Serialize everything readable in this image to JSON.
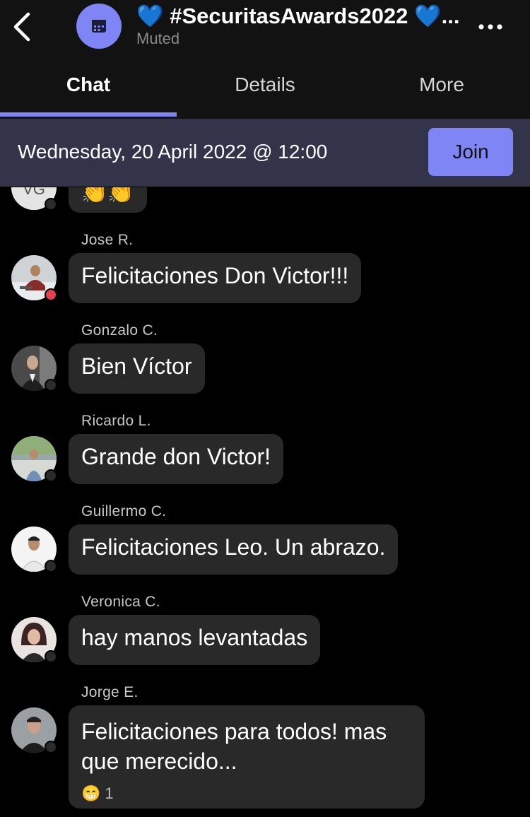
{
  "header": {
    "title": "💙 #SecuritasAwards2022 💙...",
    "subtitle": "Muted"
  },
  "tabs": [
    {
      "label": "Chat"
    },
    {
      "label": "Details"
    },
    {
      "label": "More"
    }
  ],
  "banner": {
    "text": "Wednesday, 20 April 2022 @ 12:00",
    "join_label": "Join"
  },
  "messages": [
    {
      "author": "",
      "initials": "VG",
      "text": "👏👏"
    },
    {
      "author": "Jose R.",
      "text": "Felicitaciones Don Victor!!!"
    },
    {
      "author": "Gonzalo C.",
      "text": "Bien Víctor"
    },
    {
      "author": "Ricardo L.",
      "text": "Grande don Victor!"
    },
    {
      "author": "Guillermo C.",
      "text": "Felicitaciones Leo. Un abrazo."
    },
    {
      "author": "Veronica C.",
      "text": "hay manos levantadas"
    },
    {
      "author": "Jorge E.",
      "text": "Felicitaciones para todos! mas que merecido...",
      "reaction_emoji": "😁",
      "reaction_count": "1"
    }
  ],
  "colors": {
    "accent": "#7f85f5",
    "banner_bg": "#33344a",
    "bubble_bg": "#292929",
    "busy": "#e4424d"
  }
}
